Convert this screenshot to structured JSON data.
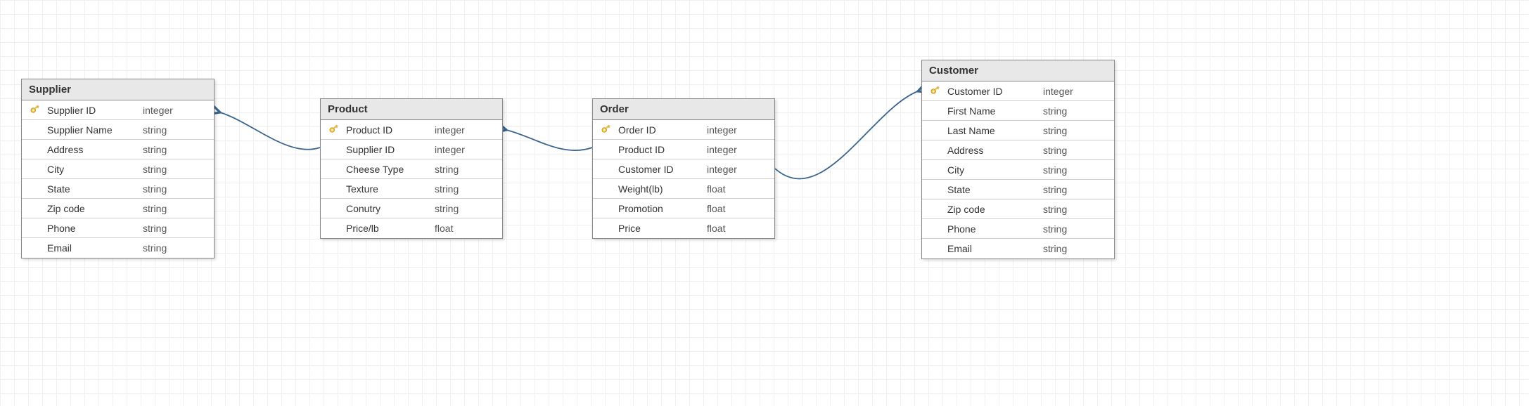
{
  "tables": {
    "supplier": {
      "title": "Supplier",
      "rows": [
        {
          "pk": true,
          "name": "Supplier ID",
          "type": "integer"
        },
        {
          "pk": false,
          "name": "Supplier Name",
          "type": "string"
        },
        {
          "pk": false,
          "name": "Address",
          "type": "string"
        },
        {
          "pk": false,
          "name": "City",
          "type": "string"
        },
        {
          "pk": false,
          "name": "State",
          "type": "string"
        },
        {
          "pk": false,
          "name": "Zip code",
          "type": "string"
        },
        {
          "pk": false,
          "name": "Phone",
          "type": "string"
        },
        {
          "pk": false,
          "name": "Email",
          "type": "string"
        }
      ]
    },
    "product": {
      "title": "Product",
      "rows": [
        {
          "pk": true,
          "name": "Product ID",
          "type": "integer"
        },
        {
          "pk": false,
          "name": "Supplier ID",
          "type": "integer"
        },
        {
          "pk": false,
          "name": "Cheese Type",
          "type": "string"
        },
        {
          "pk": false,
          "name": "Texture",
          "type": "string"
        },
        {
          "pk": false,
          "name": "Conutry",
          "type": "string"
        },
        {
          "pk": false,
          "name": "Price/lb",
          "type": "float"
        }
      ]
    },
    "order": {
      "title": "Order",
      "rows": [
        {
          "pk": true,
          "name": "Order ID",
          "type": "integer"
        },
        {
          "pk": false,
          "name": "Product ID",
          "type": "integer"
        },
        {
          "pk": false,
          "name": "Customer ID",
          "type": "integer"
        },
        {
          "pk": false,
          "name": "Weight(lb)",
          "type": "float"
        },
        {
          "pk": false,
          "name": "Promotion",
          "type": "float"
        },
        {
          "pk": false,
          "name": "Price",
          "type": "float"
        }
      ]
    },
    "customer": {
      "title": "Customer",
      "rows": [
        {
          "pk": true,
          "name": "Customer ID",
          "type": "integer"
        },
        {
          "pk": false,
          "name": "First Name",
          "type": "string"
        },
        {
          "pk": false,
          "name": "Last Name",
          "type": "string"
        },
        {
          "pk": false,
          "name": "Address",
          "type": "string"
        },
        {
          "pk": false,
          "name": "City",
          "type": "string"
        },
        {
          "pk": false,
          "name": "State",
          "type": "string"
        },
        {
          "pk": false,
          "name": "Zip code",
          "type": "string"
        },
        {
          "pk": false,
          "name": "Phone",
          "type": "string"
        },
        {
          "pk": false,
          "name": "Email",
          "type": "string"
        }
      ]
    }
  },
  "connectors": [
    {
      "id": "product-to-supplier"
    },
    {
      "id": "order-to-product"
    },
    {
      "id": "order-to-customer"
    }
  ],
  "colors": {
    "arrow": "#39658f"
  }
}
